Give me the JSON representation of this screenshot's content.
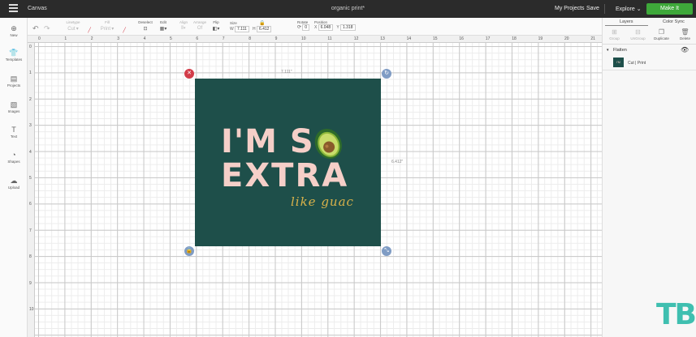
{
  "topbar": {
    "app_title": "Canvas",
    "doc_title": "organic print*",
    "my_projects": "My Projects",
    "save": "Save",
    "explore": "Explore",
    "make_it": "Make It",
    "accent": "#3ea83a"
  },
  "toolbar": {
    "linetype_label": "Linetype",
    "linetype_value": "Cut",
    "fill_label": "Fill",
    "fill_value": "Print",
    "deselect_label": "Deselect",
    "edit_label": "Edit",
    "align_label": "Align",
    "arrange_label": "Arrange",
    "arrange_value": "Of",
    "flip_label": "Flip",
    "size_label": "Size",
    "w_label": "W",
    "w_value": "7.111",
    "h_label": "H",
    "h_value": "6.412",
    "rotate_label": "Rotate",
    "rotate_value": "0",
    "position_label": "Position",
    "x_label": "X",
    "x_value": "6.048",
    "y_label": "Y",
    "y_value": "1.318"
  },
  "leftbar": {
    "items": [
      {
        "label": "New",
        "icon": "plus-icon"
      },
      {
        "label": "Templates",
        "icon": "shirt-icon"
      },
      {
        "label": "Projects",
        "icon": "projects-icon"
      },
      {
        "label": "Images",
        "icon": "image-icon"
      },
      {
        "label": "Text",
        "icon": "text-icon"
      },
      {
        "label": "Shapes",
        "icon": "shapes-icon"
      },
      {
        "label": "Upload",
        "icon": "upload-icon"
      }
    ]
  },
  "ruler": {
    "top": [
      "0",
      "1",
      "2",
      "3",
      "4",
      "5",
      "6",
      "7",
      "8",
      "9",
      "10",
      "11",
      "12",
      "13",
      "14",
      "15",
      "16",
      "17",
      "18",
      "19",
      "20",
      "21"
    ],
    "left": [
      "0",
      "1",
      "2",
      "3",
      "4",
      "5",
      "6",
      "7",
      "8",
      "9",
      "10"
    ]
  },
  "design": {
    "line1": "I'M S",
    "line2": "EXTRA",
    "line3": "like guac",
    "width_label": "7.111\"",
    "height_label": "6.412\"",
    "bg_color": "#1e4f4a",
    "text_color": "#f5cfc8",
    "script_color": "#d9b24a"
  },
  "panel": {
    "tab_layers": "Layers",
    "tab_color_sync": "Color Sync",
    "actions": [
      "Group",
      "UnGroup",
      "Duplicate",
      "Delete"
    ],
    "group_name": "Flatten",
    "layer_name": "Cut | Print"
  },
  "watermark": "TB"
}
